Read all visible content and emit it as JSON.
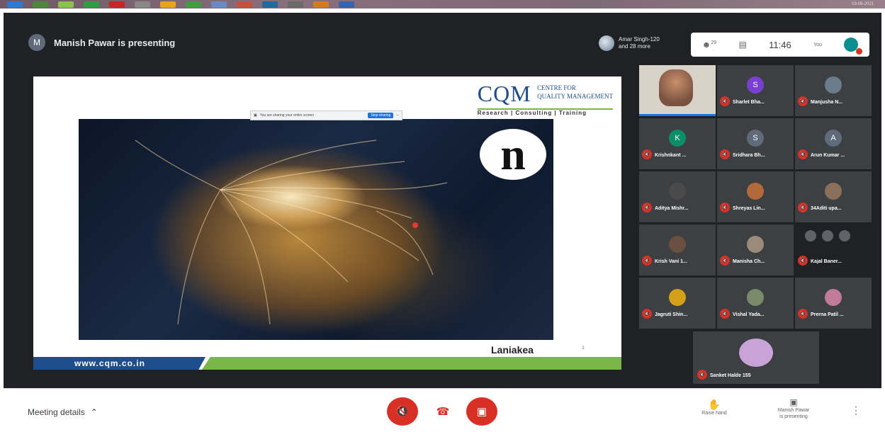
{
  "taskbar": {
    "clock": "03-06-2021",
    "icon_colors": [
      "#2e7bd6",
      "#4a8a3a",
      "#8bc34a",
      "#2e9e44",
      "#c62828",
      "#888",
      "#e8a317",
      "#3f9e3f",
      "#6a88c4",
      "#c84f3a",
      "#1f6b9e",
      "#6a6a6a",
      "#d47a1f",
      "#3565b0"
    ]
  },
  "presenter": {
    "avatar_initial": "M",
    "text": "Manish Pawar is presenting"
  },
  "participants_info": {
    "line1": "Amar Singh-120",
    "line2": "and 28 more"
  },
  "topbar": {
    "people_count": "29",
    "time": "11:46",
    "you_label": "You"
  },
  "slide": {
    "logo_main": "CQM",
    "logo_line1": "CENTRE FOR",
    "logo_line2": "QUALITY MANAGEMENT",
    "logo_tagline": "Research | Consulting | Training",
    "share_text": "You are sharing your entire screen",
    "share_button": "Stop sharing",
    "n_logo": "n",
    "caption": "Laniakea",
    "page_num": "1",
    "footer_url": "www.cqm.co.in"
  },
  "tiles": [
    {
      "name": "",
      "initial": "",
      "color": "",
      "type": "camera"
    },
    {
      "name": "Sharlet Bha...",
      "initial": "S",
      "color": "#7b3fcf"
    },
    {
      "name": "Manjusha N...",
      "initial": "",
      "color": "#6b7c8c"
    },
    {
      "name": "Krishnkant ...",
      "initial": "K",
      "color": "#0b8f6b"
    },
    {
      "name": "Sridhara Bh...",
      "initial": "S",
      "color": "#5f6b7a"
    },
    {
      "name": "Arun Kumar ...",
      "initial": "A",
      "color": "#5f6b7a"
    },
    {
      "name": "Aditya Mishr...",
      "initial": "",
      "color": "#4a4a4a"
    },
    {
      "name": "Shreyas Lin...",
      "initial": "",
      "color": "#b36a3a"
    },
    {
      "name": "34Aditi upa...",
      "initial": "",
      "color": "#8a6f5a"
    },
    {
      "name": "Krish Vani 1...",
      "initial": "",
      "color": "#6a5040"
    },
    {
      "name": "Manisha Ch...",
      "initial": "",
      "color": "#9a8a7a"
    },
    {
      "name": "Kajal Baner...",
      "initial": "",
      "color": "#202124",
      "type": "mini"
    },
    {
      "name": "Jagruti Shin...",
      "initial": "",
      "color": "#d4a017"
    },
    {
      "name": "Vishal Yada...",
      "initial": "",
      "color": "#7a8a6a"
    },
    {
      "name": "Prerna Patil ...",
      "initial": "",
      "color": "#c07a9a"
    }
  ],
  "bottom_tile": {
    "name": "Sanket Halde 155",
    "color": "#c7a3d8"
  },
  "bottom_bar": {
    "meeting_details": "Meeting details",
    "raise_hand": "Raise hand",
    "presenting_line1": "Manish Pawar",
    "presenting_line2": "is presenting"
  }
}
